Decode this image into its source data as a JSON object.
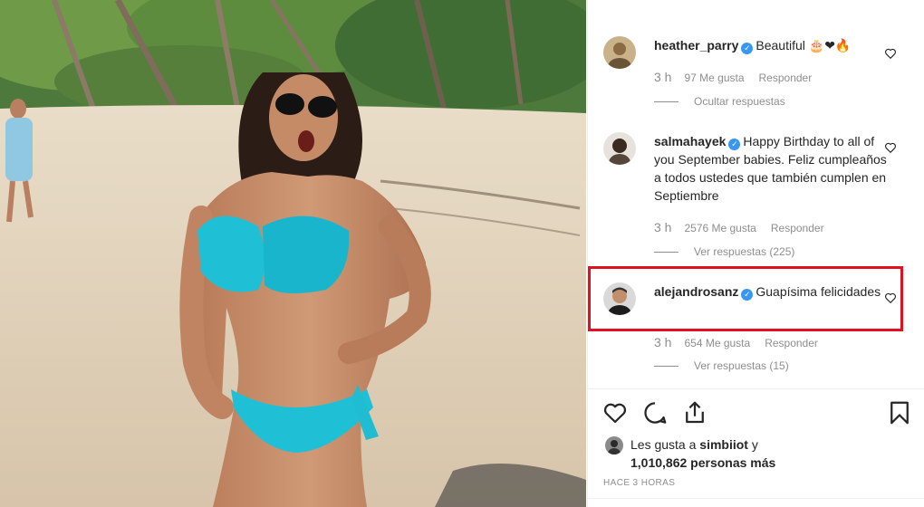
{
  "comments": [
    {
      "username": "heather_parry",
      "text": "Beautiful 🎂❤🔥",
      "age": "3 h",
      "likes": "97 Me gusta",
      "reply": "Responder",
      "replies_toggle": "Ocultar respuestas"
    },
    {
      "username": "salmahayek",
      "text": "Happy Birthday to all of you September babies. Feliz cumpleaños a todos ustedes que también cumplen en Septiembre",
      "age": "3 h",
      "likes": "2576 Me gusta",
      "reply": "Responder",
      "replies_toggle": "Ver respuestas (225)"
    },
    {
      "username": "alejandrosanz",
      "text": "Guapísima felicidades",
      "age": "3 h",
      "likes": "654 Me gusta",
      "reply": "Responder",
      "replies_toggle": "Ver respuestas (15)"
    }
  ],
  "likes_summary": {
    "prefix": "Les gusta a ",
    "user": "simbiiot",
    "middle": " y",
    "count": "1,010,862 personas más"
  },
  "post_time": "HACE 3 HORAS",
  "icons": {
    "like": "heart-icon",
    "comment": "comment-icon",
    "share": "share-icon",
    "save": "bookmark-icon",
    "verified": "verified-badge-icon"
  },
  "colors": {
    "highlight_border": "#e0121f",
    "verified": "#3897f0",
    "meta_text": "#8e8e8e"
  }
}
